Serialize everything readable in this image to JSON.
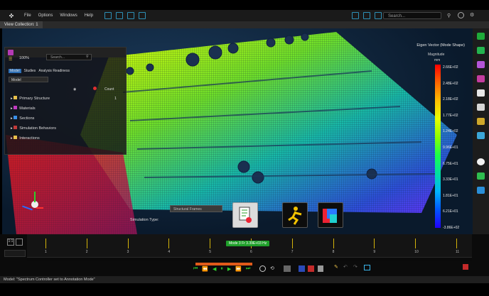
{
  "menubar": {
    "items": [
      "File",
      "Options",
      "Windows",
      "Help"
    ],
    "search_placeholder": "Search..."
  },
  "viewtitle": "View Collection: 1",
  "panel": {
    "zoom": "100%",
    "search_placeholder": "Search...",
    "tabs": [
      "Model",
      "Studies",
      "Analysis Readiness"
    ],
    "filter": "Model",
    "count_label": "Count",
    "items": [
      {
        "label": "Primary Structure",
        "value": "1"
      },
      {
        "label": "Materials",
        "value": ""
      },
      {
        "label": "Sections",
        "value": ""
      },
      {
        "label": "Simulation Behaviors",
        "value": ""
      },
      {
        "label": "Interactions",
        "value": ""
      }
    ]
  },
  "legend": {
    "title": "Eigen Vector (Mode Shape)",
    "subtitle": "Magnitude",
    "unit": "mm",
    "labels": [
      "2.66E+02",
      "2.48E+02",
      "2.18E+02",
      "1.77E+02",
      "1.24E+02",
      "9.96E+01",
      "6.75E+01",
      "3.33E+01",
      "1.81E+01",
      "6.21E+01",
      "-3.86E+02"
    ]
  },
  "controls": {
    "field_label": "Simulation Type:",
    "field_value": "Structural Frames"
  },
  "timeline": {
    "readout": "Mode 3 Fr 3.39E+03 Hz",
    "ticks": [
      "1",
      "2",
      "3",
      "4",
      "5",
      "6",
      "7",
      "8",
      "9",
      "10",
      "11"
    ]
  },
  "status": "Model: \"Spectrum Controller set to Annotation Mode\""
}
